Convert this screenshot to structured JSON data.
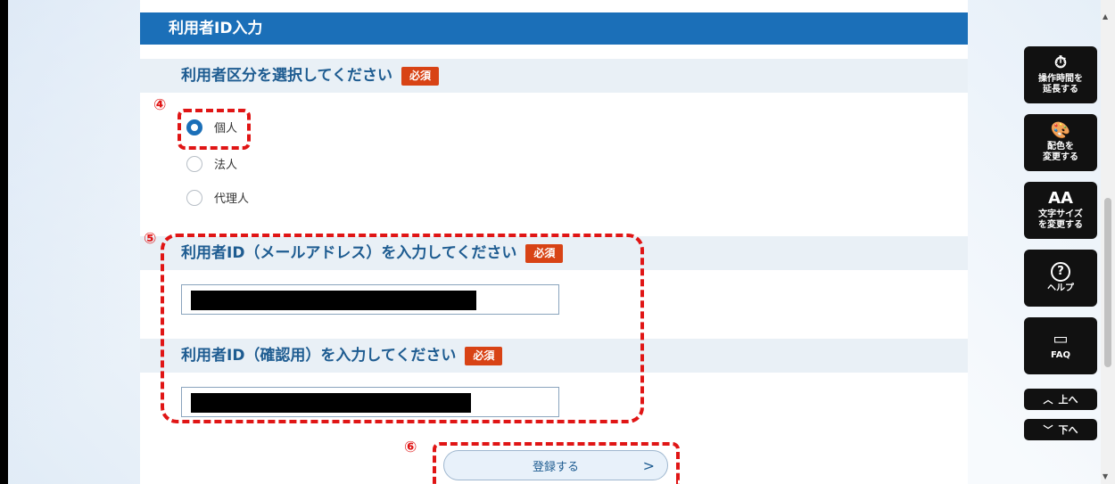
{
  "section_title": "利用者ID入力",
  "required_label": "必須",
  "user_type": {
    "question": "利用者区分を選択してください",
    "options": [
      {
        "label": "個人",
        "selected": true
      },
      {
        "label": "法人",
        "selected": false
      },
      {
        "label": "代理人",
        "selected": false
      }
    ]
  },
  "user_id": {
    "question": "利用者ID（メールアドレス）を入力してください",
    "value_redacted": true
  },
  "user_id_confirm": {
    "question": "利用者ID（確認用）を入力してください",
    "value_redacted": true
  },
  "submit_label": "登録する",
  "submit_chevron": ">",
  "annotations": {
    "step4": "④",
    "step5": "⑤",
    "step6": "⑥",
    "color": "#e01515"
  },
  "side_menu": [
    {
      "icon": "stopwatch-icon",
      "glyph": "⏱",
      "label_line1": "操作時間を",
      "label_line2": "延長する"
    },
    {
      "icon": "palette-icon",
      "glyph": "🎨",
      "label_line1": "配色を",
      "label_line2": "変更する"
    },
    {
      "icon": "text-size-icon",
      "glyph": "AA",
      "label_line1": "文字サイズ",
      "label_line2": "を変更する"
    },
    {
      "icon": "help-icon",
      "glyph": "?",
      "label_line1": "ヘルプ",
      "label_line2": ""
    },
    {
      "icon": "faq-icon",
      "glyph": "▭",
      "label_line1": "FAQ",
      "label_line2": ""
    }
  ],
  "nav": {
    "up_label": "上へ",
    "down_label": "下へ"
  },
  "colors": {
    "header_blue": "#1b6fb8",
    "question_text": "#1e5c91",
    "required_badge": "#d84315"
  }
}
